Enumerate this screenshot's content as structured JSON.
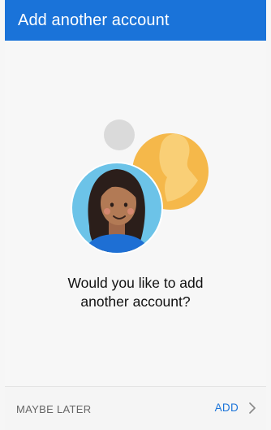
{
  "app_bar": {
    "title": "Add another account"
  },
  "prompt": {
    "line1": "Would you like to add",
    "line2": "another account?"
  },
  "footer": {
    "maybe_later_label": "MAYBE LATER",
    "add_label": "ADD"
  },
  "colors": {
    "accent": "#1a73d9",
    "avatar_bg": "#6cc3e8",
    "secondary_avatar": "#f5b84a",
    "placeholder_circle": "#dadada"
  },
  "icons": {
    "add_chevron": "chevron-right-icon"
  }
}
